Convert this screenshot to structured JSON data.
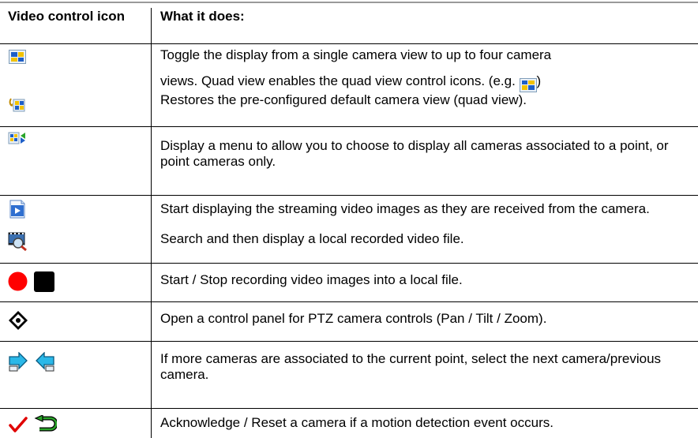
{
  "header": {
    "col_icon": "Video control icon",
    "col_desc": "What it does:"
  },
  "rows": [
    {
      "icon": "quad-view-icon",
      "text_a": "Toggle the display from a single camera view to up to four camera",
      "text_b": "views. Quad view enables the quad view control icons. (e.g. ",
      "text_c": ")"
    },
    {
      "icon": "restore-default-view-icon",
      "text": "Restores the pre-configured default camera view (quad view)."
    },
    {
      "icon": "camera-menu-icon",
      "text": "Display a menu to allow you to choose to display all cameras associated to a point, or point cameras only."
    },
    {
      "icon": "start-stream-icon",
      "text": "Start displaying the streaming video images as they are received from the camera."
    },
    {
      "icon": "search-video-file-icon",
      "text": "Search and then display a local recorded video file."
    },
    {
      "icon": "record-stop-icons",
      "text": "Start / Stop recording video images into a local file."
    },
    {
      "icon": "ptz-control-icon",
      "text": "Open a control panel for PTZ camera controls (Pan / Tilt / Zoom)."
    },
    {
      "icon": "next-previous-camera-icons",
      "text": "If more cameras are associated to the current point, select the next camera/previous camera."
    },
    {
      "icon": "acknowledge-reset-icons",
      "text": "Acknowledge / Reset a camera if a motion detection event occurs."
    }
  ],
  "colors": {
    "record": "#ff0000",
    "stop": "#000000",
    "accent_blue": "#1e5fc8",
    "accent_yellow": "#f2c200",
    "accent_green": "#2aa52a",
    "acknowledge_red": "#e00000"
  }
}
